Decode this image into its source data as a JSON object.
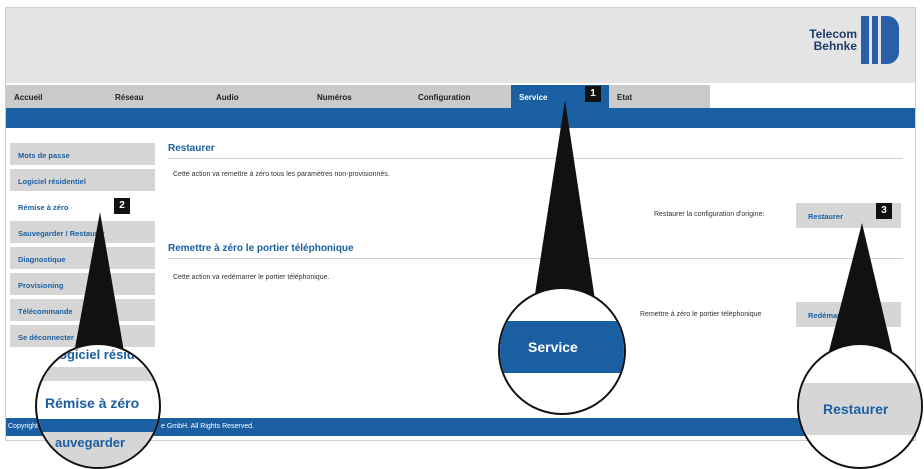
{
  "header": {
    "logo_line1": "Telecom",
    "logo_line2": "Behnke"
  },
  "nav": {
    "tabs": [
      "Accueil",
      "Réseau",
      "Audio",
      "Numéros",
      "Configuration",
      "Service",
      "Etat"
    ],
    "active": "Service"
  },
  "sidebar": {
    "items": [
      "Mots de passe",
      "Logiciel résidentiel",
      "Rémise à zéro",
      "Sauvegarder / Restaurer",
      "Diagnostique",
      "Provisioning",
      "Télécommande",
      "Se déconnecter"
    ],
    "active": "Rémise à zéro"
  },
  "restore": {
    "title": "Restaurer",
    "description": "Cette action va remettre à zéro tous les paramètres non-provisionnés.",
    "label": "Restaurer la configuration d'origine:",
    "button": "Restaurer"
  },
  "reset": {
    "title": "Remettre à zéro le portier téléphonique",
    "description": "Cette action va redémarrer le portier téléphonique.",
    "label": "Remettre à zéro le portier téléphonique",
    "button": "Redémarrer"
  },
  "footer": {
    "text_left": "Copyright",
    "text_right": "e GmbH. All Rights Reserved."
  },
  "callouts": [
    "1",
    "2",
    "3"
  ],
  "zoom": {
    "service": "Service",
    "remise_top": "ogiciel résid",
    "remise": "Rémise à zéro",
    "remise_bottom": "auvegarder",
    "restaurer": "Restaurer"
  },
  "colors": {
    "primary": "#1b5fa3",
    "header_bg": "#e4e4e4",
    "nav_bg": "#cacaca",
    "button_bg": "#d6d6d6"
  }
}
